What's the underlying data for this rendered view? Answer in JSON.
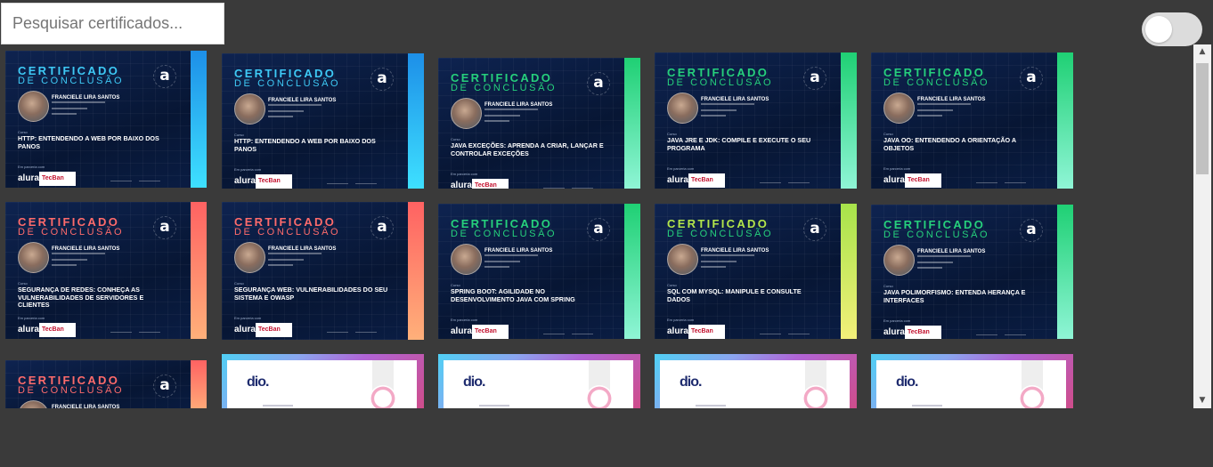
{
  "search": {
    "placeholder": "Pesquisar certificados..."
  },
  "theme_toggle": {
    "state": "off"
  },
  "colors": {
    "page_bg": "#3a3a3a",
    "cert_navy": "#071634",
    "blue_accent": "#3ec9f5",
    "green_accent": "#26d07c",
    "coral_accent": "#ff6b6b",
    "lime_accent": "#b4e64a"
  },
  "certificates": [
    {
      "heading1": "CERTIFICADO",
      "heading2": "DE CONCLUSÃO",
      "student": "FRANCIELE LIRA SANTOS",
      "course_label": "Curso",
      "course": "HTTP: ENTENDENDO A WEB POR BAIXO DOS PANOS",
      "partner_label": "Em parceria com",
      "brand": "alura",
      "partner": "TecBan",
      "theme": "blue"
    },
    {
      "heading1": "CERTIFICADO",
      "heading2": "DE CONCLUSÃO",
      "student": "FRANCIELE LIRA SANTOS",
      "course_label": "Curso",
      "course": "HTTP: ENTENDENDO A WEB POR BAIXO DOS PANOS",
      "partner_label": "Em parceria com",
      "brand": "alura",
      "partner": "TecBan",
      "theme": "blue"
    },
    {
      "heading1": "CERTIFICADO",
      "heading2": "DE CONCLUSÃO",
      "student": "FRANCIELE LIRA SANTOS",
      "course_label": "Curso",
      "course": "JAVA EXCEÇÕES: APRENDA A CRIAR, LANÇAR E CONTROLAR EXCEÇÕES",
      "partner_label": "Em parceria com",
      "brand": "alura",
      "partner": "TecBan",
      "theme": "green"
    },
    {
      "heading1": "CERTIFICADO",
      "heading2": "DE CONCLUSÃO",
      "student": "FRANCIELE LIRA SANTOS",
      "course_label": "Curso",
      "course": "JAVA JRE E JDK: COMPILE E EXECUTE O SEU PROGRAMA",
      "partner_label": "Em parceria com",
      "brand": "alura",
      "partner": "TecBan",
      "theme": "green"
    },
    {
      "heading1": "CERTIFICADO",
      "heading2": "DE CONCLUSÃO",
      "student": "FRANCIELE LIRA SANTOS",
      "course_label": "Curso",
      "course": "JAVA OO: ENTENDENDO A ORIENTAÇÃO A OBJETOS",
      "partner_label": "Em parceria com",
      "brand": "alura",
      "partner": "TecBan",
      "theme": "green"
    },
    {
      "heading1": "CERTIFICADO",
      "heading2": "DE CONCLUSÃO",
      "student": "FRANCIELE LIRA SANTOS",
      "course_label": "Curso",
      "course": "SEGURANÇA DE REDES: CONHEÇA AS VULNERABILIDADES DE SERVIDORES E CLIENTES",
      "partner_label": "Em parceria com",
      "brand": "alura",
      "partner": "TecBan",
      "theme": "coral"
    },
    {
      "heading1": "CERTIFICADO",
      "heading2": "DE CONCLUSÃO",
      "student": "FRANCIELE LIRA SANTOS",
      "course_label": "Curso",
      "course": "SEGURANÇA WEB: VULNERABILIDADES DO SEU SISTEMA E OWASP",
      "partner_label": "Em parceria com",
      "brand": "alura",
      "partner": "TecBan",
      "theme": "coral"
    },
    {
      "heading1": "CERTIFICADO",
      "heading2": "DE CONCLUSÃO",
      "student": "FRANCIELE LIRA SANTOS",
      "course_label": "Curso",
      "course": "SPRING BOOT: AGILIDADE NO DESENVOLVIMENTO JAVA COM SPRING",
      "partner_label": "Em parceria com",
      "brand": "alura",
      "partner": "TecBan",
      "theme": "green"
    },
    {
      "heading1": "CERTIFICADO",
      "heading2": "DE CONCLUSÃO",
      "student": "FRANCIELE LIRA SANTOS",
      "course_label": "Curso",
      "course": "SQL COM MYSQL: MANIPULE E CONSULTE DADOS",
      "partner_label": "Em parceria com",
      "brand": "alura",
      "partner": "TecBan",
      "theme": "lime"
    },
    {
      "heading1": "CERTIFICADO",
      "heading2": "DE CONCLUSÃO",
      "student": "FRANCIELE LIRA SANTOS",
      "course_label": "Curso",
      "course": "JAVA POLIMORFISMO: ENTENDA HERANÇA E INTERFACES",
      "partner_label": "Em parceria com",
      "brand": "alura",
      "partner": "TecBan",
      "theme": "green"
    },
    {
      "heading1": "CERTIFICADO",
      "heading2": "DE CONCLUSÃO",
      "student": "FRANCIELE LIRA SANTOS",
      "course_label": "",
      "course": "",
      "partner_label": "",
      "brand": "",
      "partner": "",
      "theme": "coral"
    },
    {
      "dio_logo": "dio.",
      "theme": "dio"
    },
    {
      "dio_logo": "dio.",
      "theme": "dio"
    },
    {
      "dio_logo": "dio.",
      "theme": "dio"
    },
    {
      "dio_logo": "dio.",
      "theme": "dio"
    }
  ]
}
